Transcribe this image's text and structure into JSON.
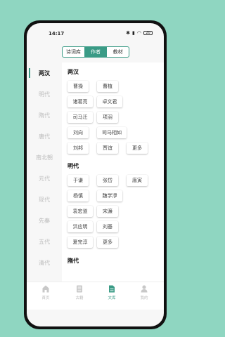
{
  "status": {
    "time": "14:17",
    "battery": "20"
  },
  "segments": [
    {
      "label": "诗词库",
      "active": false
    },
    {
      "label": "作者",
      "active": true
    },
    {
      "label": "教材",
      "active": false
    }
  ],
  "sidebar": {
    "items": [
      "两汉",
      "明代",
      "隋代",
      "唐代",
      "南北朝",
      "元代",
      "现代",
      "先秦",
      "五代",
      "清代"
    ],
    "active": "两汉"
  },
  "sections": [
    {
      "title": "两汉",
      "authors": [
        "曹操",
        "曹植",
        "诸葛亮",
        "卓文君",
        "司马迁",
        "项羽",
        "刘向",
        "司马相如",
        "刘邦",
        "贾谊",
        "更多"
      ]
    },
    {
      "title": "明代",
      "authors": [
        "于谦",
        "张岱",
        "唐寅",
        "杨慎",
        "魏学洢",
        "袁宏道",
        "宋濂",
        "洪应明",
        "刘基",
        "夏完淳",
        "更多"
      ]
    },
    {
      "title": "隋代",
      "authors": []
    }
  ],
  "tabbar": [
    {
      "label": "首页",
      "icon": "home-icon",
      "active": false
    },
    {
      "label": "古籍",
      "icon": "book-icon",
      "active": false
    },
    {
      "label": "文库",
      "icon": "document-icon",
      "active": true
    },
    {
      "label": "我的",
      "icon": "person-icon",
      "active": false
    }
  ],
  "colors": {
    "accent": "#3a9b86",
    "background": "#8fd6c1"
  }
}
